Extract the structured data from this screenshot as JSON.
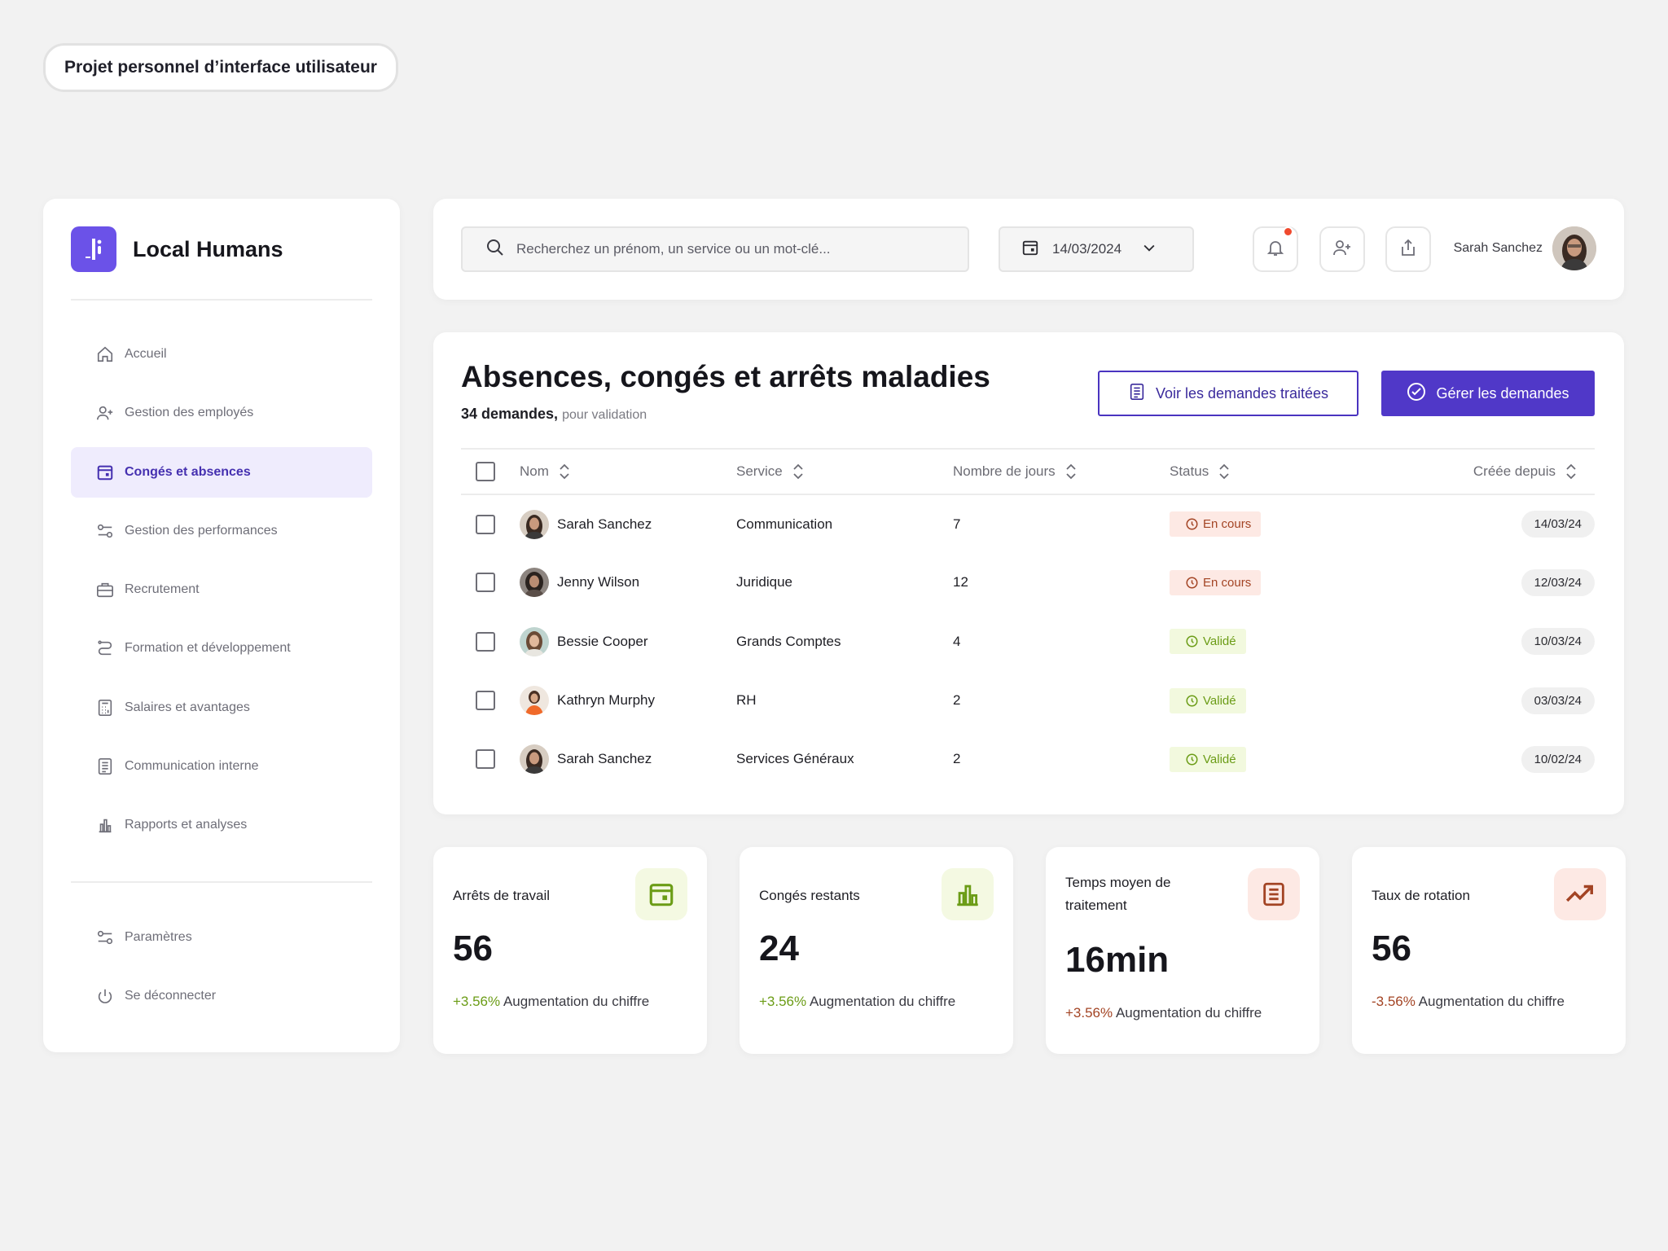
{
  "project_tag": "Projet personnel d’interface utilisateur",
  "brand": {
    "name": "Local Humans",
    "accent": "#6b52e8"
  },
  "nav": {
    "items": [
      {
        "label": "Accueil",
        "icon": "home-icon"
      },
      {
        "label": "Gestion des employés",
        "icon": "user-plus-icon"
      },
      {
        "label": "Congés et absences",
        "icon": "calendar-icon",
        "active": true
      },
      {
        "label": "Gestion des performances",
        "icon": "sliders-icon"
      },
      {
        "label": "Recrutement",
        "icon": "briefcase-icon"
      },
      {
        "label": "Formation et développement",
        "icon": "route-icon"
      },
      {
        "label": "Salaires et avantages",
        "icon": "calculator-icon"
      },
      {
        "label": "Communication interne",
        "icon": "document-icon"
      },
      {
        "label": "Rapports et analyses",
        "icon": "bar-chart-icon"
      }
    ],
    "footer": [
      {
        "label": "Paramètres",
        "icon": "settings-icon"
      },
      {
        "label": "Se déconnecter",
        "icon": "power-icon"
      }
    ]
  },
  "topbar": {
    "search_placeholder": "Recherchez un prénom, un service ou un mot-clé...",
    "date": "14/03/2024",
    "user_name": "Sarah Sanchez"
  },
  "main": {
    "title": "Absences, congés et arrêts maladies",
    "count": "34 demandes,",
    "count_suffix": "pour validation",
    "btn_secondary": "Voir les demandes traitées",
    "btn_primary": "Gérer les demandes",
    "columns": [
      "Nom",
      "Service",
      "Nombre de jours",
      "Status",
      "Créée depuis"
    ],
    "rows": [
      {
        "name": "Sarah Sanchez",
        "service": "Communication",
        "days": "7",
        "status": "En cours",
        "date": "14/03/24"
      },
      {
        "name": "Jenny Wilson",
        "service": "Juridique",
        "days": "12",
        "status": "En cours",
        "date": "12/03/24"
      },
      {
        "name": "Bessie Cooper",
        "service": "Grands Comptes",
        "days": "4",
        "status": "Validé",
        "date": "10/03/24"
      },
      {
        "name": "Kathryn Murphy",
        "service": "RH",
        "days": "2",
        "status": "Validé",
        "date": "03/03/24"
      },
      {
        "name": "Sarah Sanchez",
        "service": "Services Généraux",
        "days": "2",
        "status": "Validé",
        "date": "10/02/24"
      }
    ]
  },
  "kpis": [
    {
      "label": "Arrêts de travail",
      "value": "56",
      "delta": "+3.56%",
      "delta_text": "Augmentation du chiffre",
      "icon": "calendar-icon"
    },
    {
      "label": "Congés restants",
      "value": "24",
      "delta": "+3.56%",
      "delta_text": "Augmentation du chiffre",
      "icon": "bar-chart-icon"
    },
    {
      "label": "Temps moyen de traitement",
      "value": "16min",
      "delta": "+3.56%",
      "delta_text": "Augmentation du chiffre",
      "icon": "document-icon"
    },
    {
      "label": "Taux de rotation",
      "value": "56",
      "delta": "-3.56%",
      "delta_text": "Augmentation du chiffre",
      "icon": "trend-up-icon"
    }
  ],
  "colors": {
    "primary": "#5038c8",
    "pending_bg": "#fde9e4",
    "pending_fg": "#a34424",
    "ok_bg": "#f2f9de",
    "ok_fg": "#6b9c16"
  }
}
